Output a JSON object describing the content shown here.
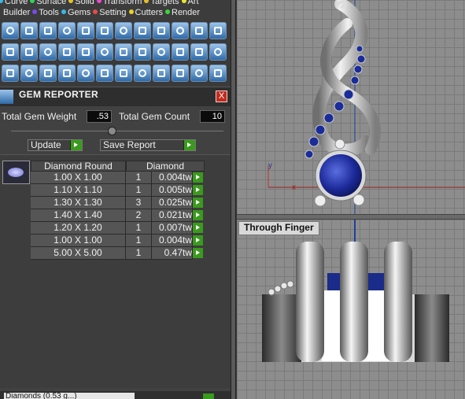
{
  "menu": {
    "row1": [
      {
        "label": "Curve",
        "color": "#3bb6e8"
      },
      {
        "label": "Surface",
        "color": "#2fd35a"
      },
      {
        "label": "Solid",
        "color": "#e0c32a"
      },
      {
        "label": "Transform",
        "color": "#e84ad0"
      },
      {
        "label": "Targets",
        "color": "#e8bd2a"
      },
      {
        "label": "Art",
        "color": "#e8e82a"
      }
    ],
    "row2": [
      {
        "label": "Builder",
        "color": ""
      },
      {
        "label": "Tools",
        "color": "#7a4ae8"
      },
      {
        "label": "Gems",
        "color": "#3bb6e8"
      },
      {
        "label": "Setting",
        "color": "#e84a4a"
      },
      {
        "label": "Cutters",
        "color": "#e8d22a"
      },
      {
        "label": "Render",
        "color": "#3ad83a"
      }
    ]
  },
  "panel": {
    "title": "GEM REPORTER",
    "close_label": "X",
    "total_weight_label": "Total Gem Weight",
    "total_weight_value": ".53",
    "total_count_label": "Total Gem Count",
    "total_count_value": "10",
    "update_label": "Update",
    "save_report_label": "Save Report"
  },
  "table": {
    "headers": [
      "Diamond Round",
      "Diamond"
    ],
    "rows": [
      {
        "size": "1.00 X 1.00",
        "qty": "1",
        "weight": "0.004tw"
      },
      {
        "size": "1.10 X 1.10",
        "qty": "1",
        "weight": "0.005tw"
      },
      {
        "size": "1.30 X 1.30",
        "qty": "3",
        "weight": "0.025tw"
      },
      {
        "size": "1.40 X 1.40",
        "qty": "2",
        "weight": "0.021tw"
      },
      {
        "size": "1.20 X 1.20",
        "qty": "1",
        "weight": "0.007tw"
      },
      {
        "size": "1.00 X 1.00",
        "qty": "1",
        "weight": "0.004tw"
      },
      {
        "size": "5.00 X 5.00",
        "qty": "1",
        "weight": "0.47tw"
      }
    ]
  },
  "bottom": {
    "select_label": "Diamonds (0.53 g...)"
  },
  "viewport_top": {
    "axis_y": "y",
    "axis_x": "x"
  },
  "viewport_bottom": {
    "label": "Through Finger"
  }
}
